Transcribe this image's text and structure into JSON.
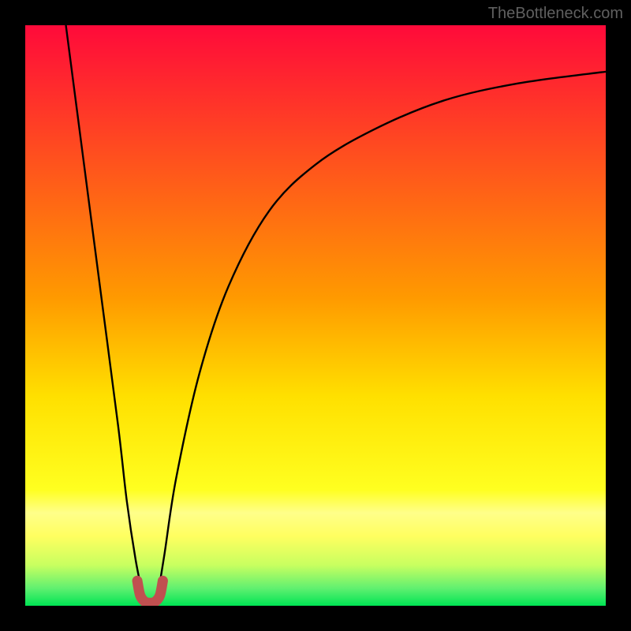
{
  "attribution": "TheBottleneck.com",
  "colors": {
    "top": "#ff0a3a",
    "mid": "#ffe000",
    "band": "#ffff8a",
    "bottom": "#00e454",
    "curve": "#000000",
    "marker": "#c05050",
    "frame": "#000000"
  },
  "chart_data": {
    "type": "line",
    "title": "",
    "xlabel": "",
    "ylabel": "",
    "xlim": [
      0,
      100
    ],
    "ylim": [
      0,
      100
    ],
    "series": [
      {
        "name": "left-branch",
        "x": [
          7,
          10,
          13,
          16,
          17.5,
          19,
          20.3
        ],
        "values": [
          100,
          77,
          54,
          31,
          18,
          8,
          1.5
        ]
      },
      {
        "name": "right-branch",
        "x": [
          22.8,
          24,
          26,
          30,
          35,
          42,
          50,
          60,
          72,
          85,
          100
        ],
        "values": [
          1.5,
          9,
          22,
          40,
          55,
          68,
          76,
          82,
          87,
          90,
          92
        ]
      },
      {
        "name": "trough-marker",
        "x": [
          19.3,
          19.8,
          20.6,
          21.5,
          22.4,
          23.2,
          23.7
        ],
        "values": [
          4.3,
          1.8,
          0.7,
          0.5,
          0.7,
          1.8,
          4.3
        ]
      }
    ]
  }
}
